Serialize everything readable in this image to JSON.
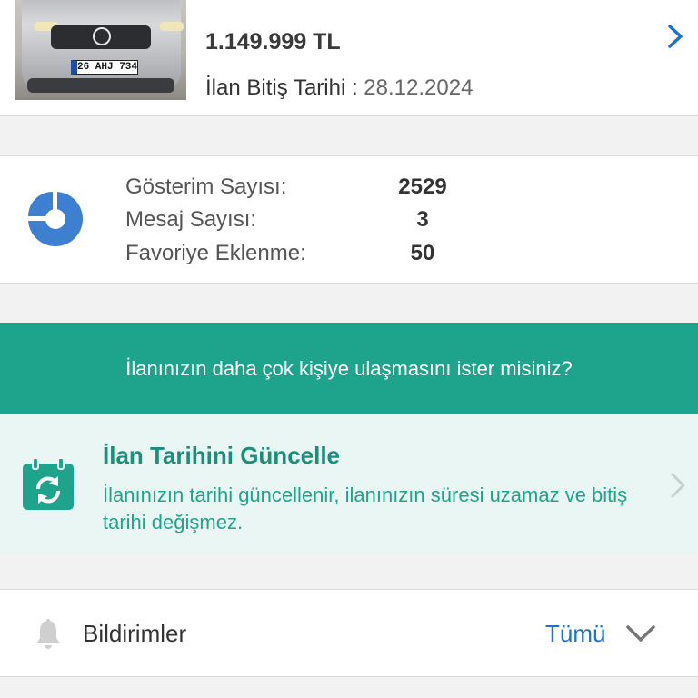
{
  "listing": {
    "plate": "26 AHJ 734",
    "price": "1.149.999 TL",
    "end_date_label": "İlan Bitiş Tarihi : ",
    "end_date_value": "28.12.2024"
  },
  "stats": {
    "rows": [
      {
        "label": "Gösterim Sayısı:",
        "value": "2529"
      },
      {
        "label": "Mesaj Sayısı:",
        "value": "3"
      },
      {
        "label": "Favoriye Eklenme:",
        "value": "50"
      }
    ]
  },
  "promo": {
    "text": "İlanınızın daha çok kişiye ulaşmasını ister misiniz?"
  },
  "update": {
    "title": "İlan Tarihini Güncelle",
    "description": "İlanınızın tarihi güncellenir, ilanınızın süresi uzamaz ve bitiş tarihi değişmez."
  },
  "notifications": {
    "label": "Bildirimler",
    "filter": "Tümü"
  },
  "colors": {
    "teal": "#1ea48d",
    "link_blue": "#1e72c8",
    "icon_blue": "#3d7fd0"
  },
  "icons": [
    "chevron-right-icon",
    "pie-chart-icon",
    "calendar-refresh-icon",
    "bell-icon",
    "chevron-down-icon"
  ]
}
